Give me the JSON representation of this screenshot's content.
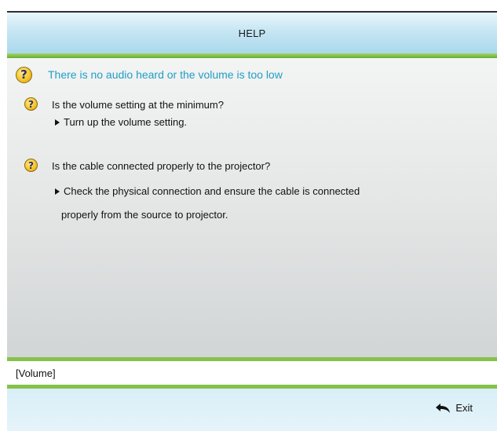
{
  "header": {
    "title": "HELP"
  },
  "topic": {
    "title": "There is no audio heard or the volume is too low",
    "icon": "question-icon"
  },
  "items": [
    {
      "icon": "question-icon",
      "question": "Is the volume setting at the minimum?",
      "answer_lines": [
        "Turn up the volume setting."
      ]
    },
    {
      "icon": "question-icon",
      "question": "Is the cable connected properly to the projector?",
      "answer_lines": [
        "Check the physical connection and ensure the cable is connected",
        "properly from the source to projector."
      ]
    }
  ],
  "context_bar": {
    "label": "[Volume]"
  },
  "footer": {
    "exit_label": "Exit",
    "exit_icon": "return-arrow-icon"
  },
  "colors": {
    "accent_cyan": "#1f9fc4",
    "accent_green": "#84c24a",
    "header_blue": "#a9d9ec"
  }
}
